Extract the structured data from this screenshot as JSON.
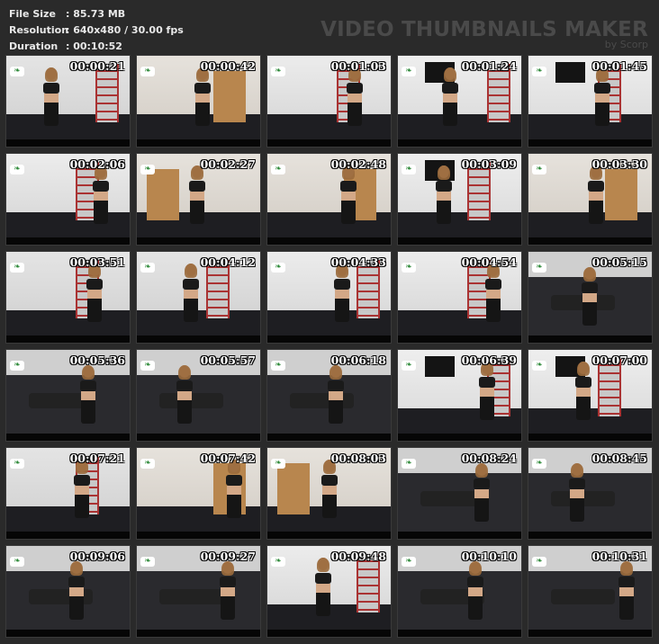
{
  "info": {
    "file_size_label": "File Size",
    "file_size_value": ": 85.73 MB",
    "resolution_label": "Resolution",
    "resolution_value": ": 640x480 / 30.00 fps",
    "duration_label": "Duration",
    "duration_value": ": 00:10:52"
  },
  "brand": {
    "title": "VIDEO THUMBNAILS MAKER",
    "subtitle": "by Scorp"
  },
  "thumbnails": [
    {
      "time": "00:00:21",
      "scene": "white"
    },
    {
      "time": "00:00:42",
      "scene": "door"
    },
    {
      "time": "00:01:03",
      "scene": "rack"
    },
    {
      "time": "00:01:24",
      "scene": "tv"
    },
    {
      "time": "00:01:45",
      "scene": "tv"
    },
    {
      "time": "00:02:06",
      "scene": "rack"
    },
    {
      "time": "00:02:27",
      "scene": "door"
    },
    {
      "time": "00:02:48",
      "scene": "door"
    },
    {
      "time": "00:03:09",
      "scene": "tv"
    },
    {
      "time": "00:03:30",
      "scene": "door"
    },
    {
      "time": "00:03:51",
      "scene": "white"
    },
    {
      "time": "00:04:12",
      "scene": "white"
    },
    {
      "time": "00:04:33",
      "scene": "rack"
    },
    {
      "time": "00:04:54",
      "scene": "rack"
    },
    {
      "time": "00:05:15",
      "scene": "floor"
    },
    {
      "time": "00:05:36",
      "scene": "floor"
    },
    {
      "time": "00:05:57",
      "scene": "floor"
    },
    {
      "time": "00:06:18",
      "scene": "floor"
    },
    {
      "time": "00:06:39",
      "scene": "tv"
    },
    {
      "time": "00:07:00",
      "scene": "tv"
    },
    {
      "time": "00:07:21",
      "scene": "white"
    },
    {
      "time": "00:07:42",
      "scene": "door"
    },
    {
      "time": "00:08:03",
      "scene": "door"
    },
    {
      "time": "00:08:24",
      "scene": "floor"
    },
    {
      "time": "00:08:45",
      "scene": "floor"
    },
    {
      "time": "00:09:06",
      "scene": "floor"
    },
    {
      "time": "00:09:27",
      "scene": "floor"
    },
    {
      "time": "00:09:48",
      "scene": "rack"
    },
    {
      "time": "00:10:10",
      "scene": "floor"
    },
    {
      "time": "00:10:31",
      "scene": "floor"
    }
  ],
  "colors": {
    "background": "#2a2a2a",
    "info_text": "#e8e8e8",
    "brand_text": "#4a4a4a",
    "logo_green": "#2f8a3a"
  }
}
